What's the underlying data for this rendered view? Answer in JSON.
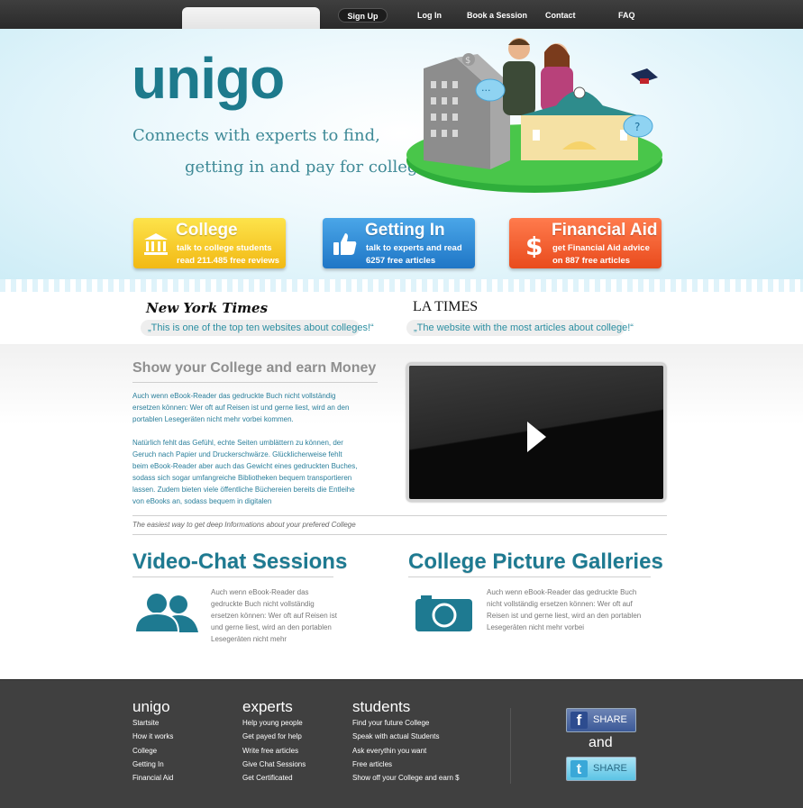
{
  "nav": {
    "signup": "Sign Up",
    "login": "Log In",
    "book": "Book a Session",
    "contact": "Contact",
    "faq": "FAQ"
  },
  "hero": {
    "logo": "unigo",
    "tagline_line1": "Connects with experts to find,",
    "tagline_line2": "getting in and pay for college"
  },
  "cta": [
    {
      "title": "College",
      "line1": "talk to college students",
      "line2": "read 211.485 free reviews",
      "icon": "bank-icon",
      "color": "#f7c826"
    },
    {
      "title": "Getting In",
      "line1": "talk to experts and read",
      "line2": "6257 free articles",
      "icon": "thumbs-up-icon",
      "color": "#2f8ad6"
    },
    {
      "title": "Financial Aid",
      "line1": "get Financial Aid advice",
      "line2": "on 887 free articles",
      "icon": "dollar-icon",
      "color": "#f15d2d"
    }
  ],
  "press": {
    "nyt_name": "New York Times",
    "nyt_quote": "„This is one of the top ten websites about colleges!“",
    "lat_name": "LA TIMES",
    "lat_quote": "„The website with the most articles about college!“"
  },
  "main": {
    "section_title": "Show your College and earn Money",
    "para1": "Auch wenn eBook-Reader das gedruckte Buch nicht vollständig ersetzen können: Wer oft auf Reisen ist und gerne liest, wird an den portablen Lesegeräten nicht mehr vorbei kommen.",
    "para2": "Natürlich fehlt das Gefühl, echte Seiten umblättern zu können, der Geruch nach Papier und Druckerschwärze. Glücklicherweise fehlt beim eBook-Reader aber auch das Gewicht eines gedruckten Buches, sodass sich sogar umfangreiche Bibliotheken bequem transportieren lassen. Zudem bieten viele öffentliche Büchereien bereits die Entleihe von eBooks an, sodass bequem in digitalen",
    "caption": "The easiest way to get deep Informations about your prefered College"
  },
  "features": {
    "video_chat_title": "Video-Chat Sessions",
    "video_chat_text": "Auch wenn eBook-Reader das gedruckte Buch nicht vollständig ersetzen können: Wer oft auf Reisen ist und gerne liest, wird an den portablen Lesegeräten nicht mehr",
    "gallery_title": "College Picture Galleries",
    "gallery_text": "Auch wenn eBook-Reader das gedruckte Buch nicht vollständig ersetzen können: Wer oft auf Reisen ist und gerne liest, wird an den portablen Lesegeräten nicht mehr vorbei"
  },
  "footer": {
    "col1_title": "unigo",
    "col1": [
      "Startsite",
      "How it works",
      "College",
      "Getting In",
      "Financial Aid"
    ],
    "col2_title": "experts",
    "col2": [
      "Help young people",
      "Get payed for help",
      "Write free articles",
      "Give Chat Sessions",
      "Get Certificated"
    ],
    "col3_title": "students",
    "col3": [
      "Find your future College",
      "Speak with actual Students",
      "Ask everythin you want",
      "Free articles",
      "Show off your College and earn $"
    ],
    "share_fb": "SHARE",
    "share_and": "and",
    "share_tw": "SHARE"
  }
}
